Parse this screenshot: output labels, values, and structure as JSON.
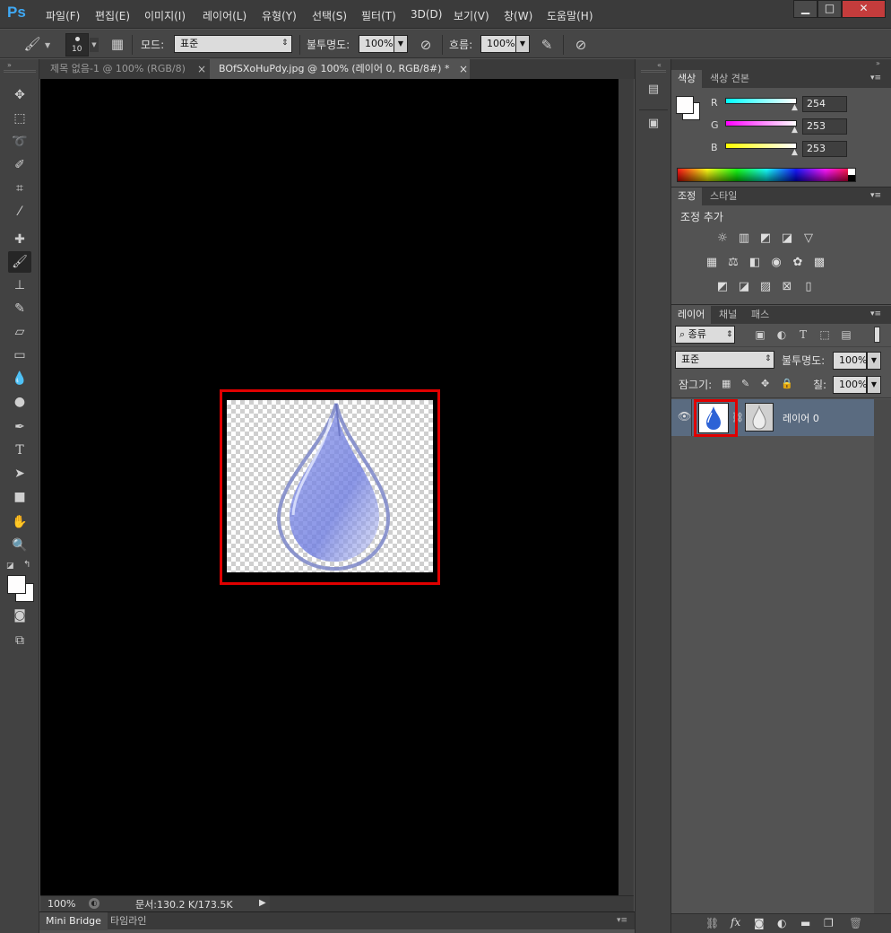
{
  "app": {
    "logo": "Ps"
  },
  "menu": [
    "파일(F)",
    "편집(E)",
    "이미지(I)",
    "레이어(L)",
    "유형(Y)",
    "선택(S)",
    "필터(T)",
    "3D(D)",
    "보기(V)",
    "창(W)",
    "도움말(H)"
  ],
  "window_controls": {
    "minimize": "▁",
    "maximize": "□",
    "close": "✕"
  },
  "options": {
    "brush_size": "10",
    "mode_label": "모드:",
    "mode_value": "표준",
    "opacity_label": "불투명도:",
    "opacity_value": "100%",
    "flow_label": "흐름:",
    "flow_value": "100%"
  },
  "doc_tabs": [
    {
      "label": "제목 없음-1 @ 100% (RGB/8)",
      "close": "×",
      "active": false
    },
    {
      "label": "BOfSXoHuPdy.jpg @ 100% (레이어 0, RGB/8#) *",
      "close": "×",
      "active": true
    }
  ],
  "status": {
    "zoom": "100%",
    "doc_info": "문서:130.2 K/173.5K"
  },
  "bottom_tabs": [
    "Mini Bridge",
    "타임라인"
  ],
  "color_panel": {
    "tabs": [
      "색상",
      "색상 견본"
    ],
    "channels": [
      {
        "label": "R",
        "value": "254"
      },
      {
        "label": "G",
        "value": "253"
      },
      {
        "label": "B",
        "value": "253"
      }
    ]
  },
  "adjustments_panel": {
    "tabs": [
      "조정",
      "스타일"
    ],
    "title": "조정 추가"
  },
  "layers_panel": {
    "tabs": [
      "레이어",
      "채널",
      "패스"
    ],
    "filter_label": "종류",
    "blend_mode": "표준",
    "opacity_label": "불투명도:",
    "opacity_value": "100%",
    "lock_label": "잠그기:",
    "fill_label": "칠:",
    "fill_value": "100%",
    "layers": [
      {
        "name": "레이어 0",
        "visible": true
      }
    ]
  },
  "icons": {
    "tools": [
      "move-icon",
      "marquee-icon",
      "lasso-icon",
      "quick-select-icon",
      "crop-icon",
      "eyedropper-icon",
      "healing-icon",
      "brush-icon",
      "stamp-icon",
      "history-brush-icon",
      "eraser-icon",
      "gradient-icon",
      "blur-icon",
      "dodge-icon",
      "pen-icon",
      "type-icon",
      "path-select-icon",
      "rectangle-icon",
      "hand-icon",
      "zoom-icon"
    ]
  },
  "colors": {
    "highlight_box": "#e00000",
    "selected_layer_bg": "#5a6b80",
    "accent": "#3fa9f5"
  }
}
